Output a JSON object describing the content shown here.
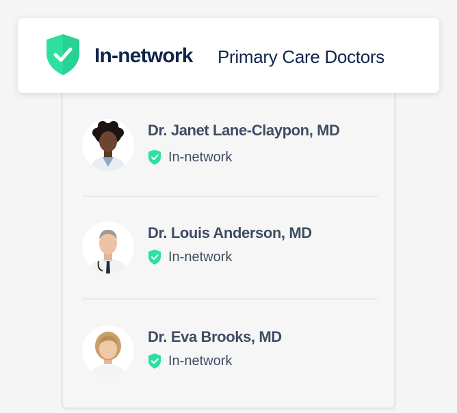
{
  "header": {
    "title": "In-network",
    "subtitle": "Primary Care Doctors",
    "icon": "shield-check-icon"
  },
  "colors": {
    "accent_green": "#2ee0a0",
    "navy": "#11254a",
    "text": "#3f4d63"
  },
  "doctors": [
    {
      "name": "Dr. Janet Lane-Claypon, MD",
      "status": "In-network",
      "status_icon": "shield-check-icon"
    },
    {
      "name": "Dr. Louis Anderson, MD",
      "status": "In-network",
      "status_icon": "shield-check-icon"
    },
    {
      "name": "Dr. Eva Brooks, MD",
      "status": "In-network",
      "status_icon": "shield-check-icon"
    }
  ]
}
